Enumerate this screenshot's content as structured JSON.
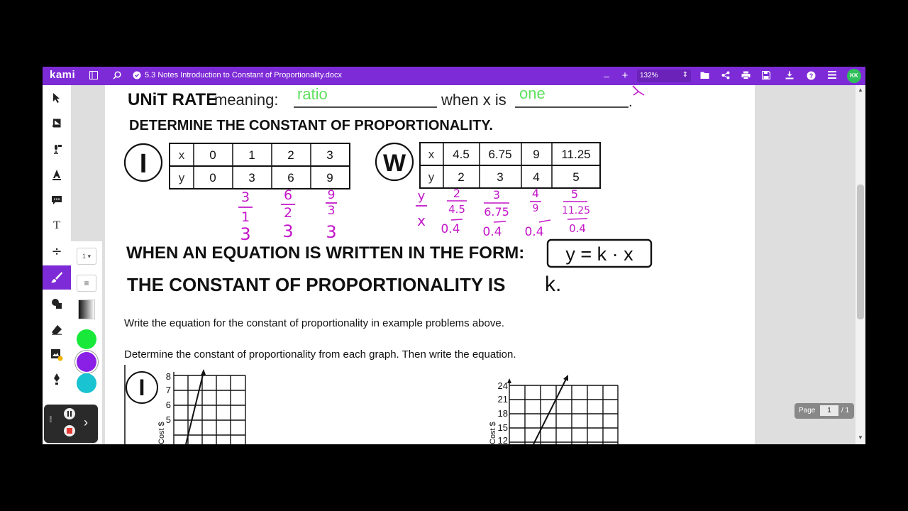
{
  "app": {
    "logo": "kami",
    "document_title": "5.3 Notes Introduction to Constant of Proportionality.docx"
  },
  "zoom": {
    "value": "132%",
    "minus": "–",
    "plus": "+"
  },
  "user": {
    "initials": "KK"
  },
  "subtoolbar": {
    "size": "1"
  },
  "colors": {
    "brand": "#7d2bd6",
    "green": "#17e83a",
    "purple": "#8a1fe6",
    "teal": "#19c3d1",
    "annotation_magenta": "#c316c9",
    "annotation_green": "#5fe05f"
  },
  "page_nav": {
    "label": "Page",
    "current": "1",
    "total": "/ 1"
  },
  "worksheet": {
    "unit_rate_label": "UNiT RATE",
    "meaning_label": "meaning:",
    "blank1_answer": "ratio",
    "when_x_is": "when x is",
    "blank2_answer": "one",
    "blank_end": ".",
    "heading": "DETERMINE THE CONSTANT OF PROPORTIONALITY.",
    "label_i": "I",
    "label_w": "W",
    "table_i": {
      "x_label": "x",
      "y_label": "y",
      "x": [
        "0",
        "1",
        "2",
        "3"
      ],
      "y": [
        "0",
        "3",
        "6",
        "9"
      ]
    },
    "table_w": {
      "x_label": "x",
      "y_label": "y",
      "x": [
        "4.5",
        "6.75",
        "9",
        "11.25"
      ],
      "y": [
        "2",
        "3",
        "4",
        "5"
      ]
    },
    "work_i": [
      {
        "num": "3",
        "den": "1",
        "result": "3"
      },
      {
        "num": "6",
        "den": "2",
        "result": "3"
      },
      {
        "num": "9",
        "den": "3",
        "result": "3"
      }
    ],
    "work_w": {
      "ratio": {
        "num": "y",
        "den": "x"
      },
      "items": [
        {
          "num": "2",
          "den": "4.5",
          "result": "0.4"
        },
        {
          "num": "3",
          "den": "6.75",
          "result": "0.4"
        },
        {
          "num": "4",
          "den": "9",
          "result": "0.4"
        },
        {
          "num": "5",
          "den": "11.25",
          "result": "0.4"
        }
      ]
    },
    "equation_lead": "WHEN AN EQUATION IS WRITTEN IN THE FORM:",
    "equation": "y = k · x",
    "constant_line": "THE CONSTANT OF PROPORTIONALITY IS",
    "constant_symbol": "k.",
    "instruction1": "Write the equation for the constant of proportionality in example problems above.",
    "instruction2": "Determine the constant of proportionality from each graph.  Then write the equation.",
    "graph1": {
      "label": "I",
      "y_ticks": [
        "8",
        "7",
        "6",
        "5"
      ],
      "axis_label": "Cost $"
    },
    "graph2": {
      "y_ticks": [
        "24",
        "21",
        "18",
        "15",
        "12"
      ],
      "axis_label": "Cost $"
    }
  }
}
